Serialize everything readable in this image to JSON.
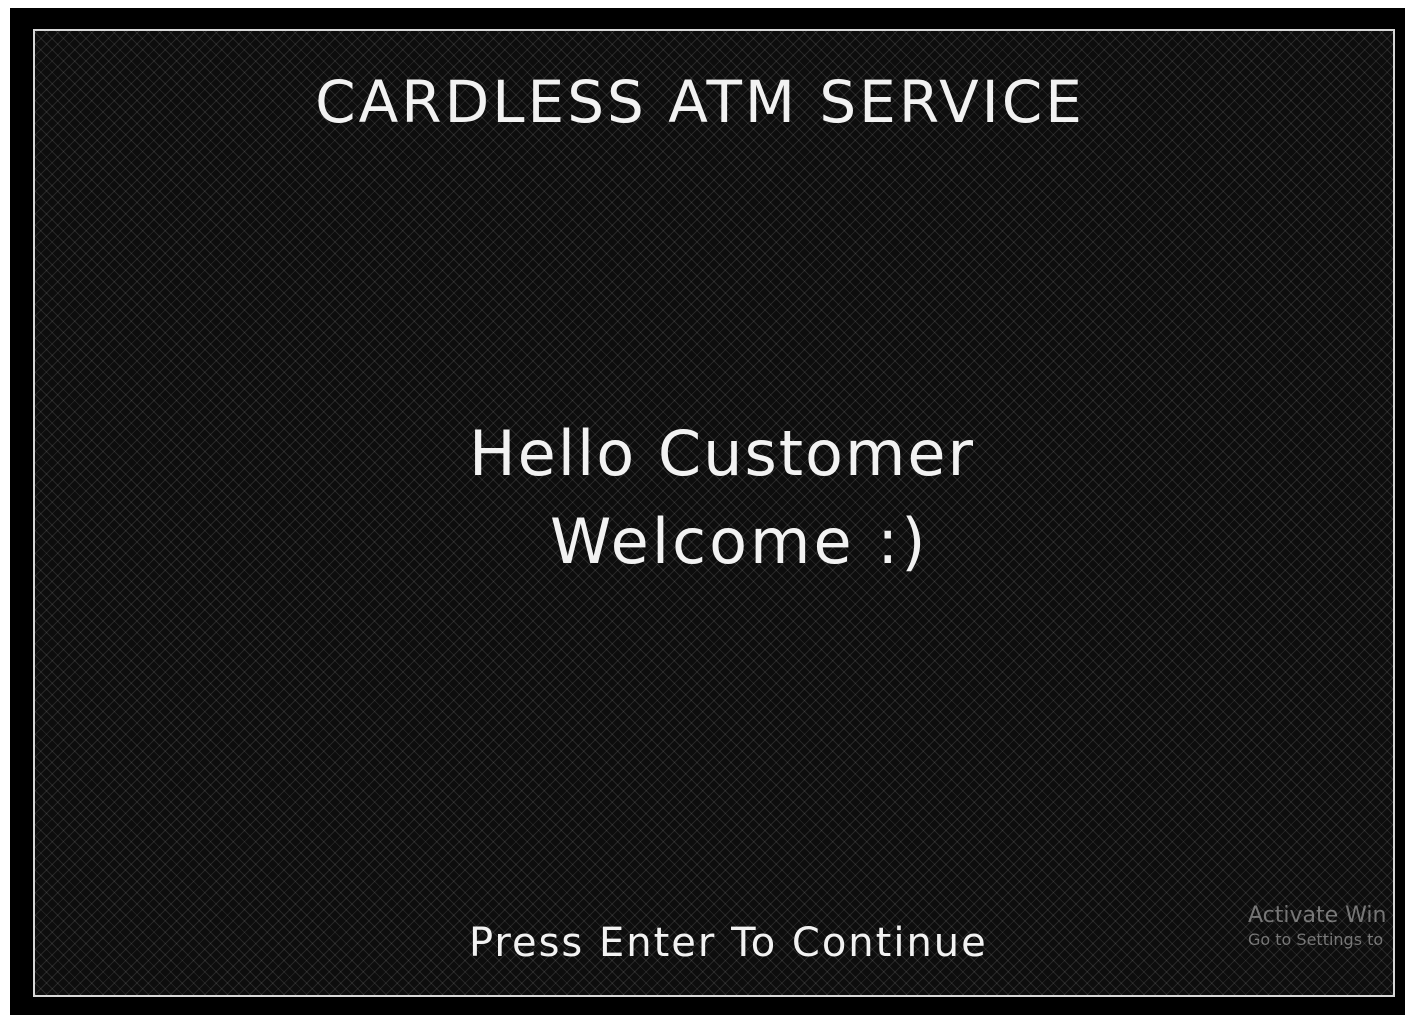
{
  "screen": {
    "title": "CARDLESS ATM SERVICE",
    "greeting_line1": "Hello Customer",
    "greeting_line2": "Welcome :)",
    "prompt": "Press Enter To Continue"
  },
  "watermark": {
    "line1": "Activate Win",
    "line2": "Go to Settings to"
  },
  "colors": {
    "background": "#000000",
    "text": "#f2f2f2",
    "border": "#d8d8d8"
  }
}
